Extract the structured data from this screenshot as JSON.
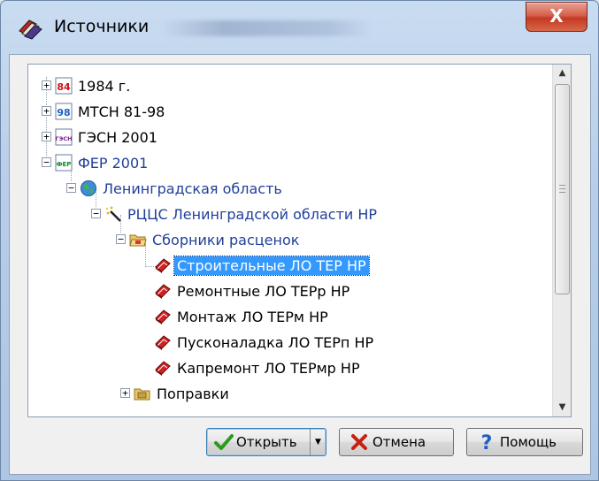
{
  "window": {
    "title": "Источники",
    "close_glyph": "X"
  },
  "tree": {
    "nodes": [
      {
        "label": "1984 г.",
        "icon": "book-84-icon",
        "icon_text": "84"
      },
      {
        "label": "МТСН 81-98",
        "icon": "book-98-icon",
        "icon_text": "98"
      },
      {
        "label": "ГЭСН 2001",
        "icon": "book-gesn-icon",
        "icon_text": "ГЭСН"
      },
      {
        "label": "ФЕР 2001",
        "icon": "book-fer-icon",
        "icon_text": "ФЕР"
      },
      {
        "label": "Ленинградская область",
        "icon": "globe-icon"
      },
      {
        "label": "РЦЦС Ленинградской области НР",
        "icon": "magic-wand-icon"
      },
      {
        "label": "Сборники расценок",
        "icon": "open-folder-icon"
      },
      {
        "label": "Строительные ЛО ТЕР НР",
        "icon": "red-book-icon",
        "selected": true
      },
      {
        "label": "Ремонтные ЛО ТЕРр НР",
        "icon": "red-book-icon"
      },
      {
        "label": "Монтаж ЛО ТЕРм НР",
        "icon": "red-book-icon"
      },
      {
        "label": "Пусконаладка ЛО ТЕРп НР",
        "icon": "red-book-icon"
      },
      {
        "label": "Капремонт ЛО ТЕРмр НР",
        "icon": "red-book-icon"
      },
      {
        "label": "Поправки",
        "icon": "folder-icon"
      }
    ]
  },
  "buttons": {
    "open": "Открыть",
    "cancel": "Отмена",
    "help": "Помощь"
  },
  "colors": {
    "selection": "#3399ff",
    "link_text": "#1f3f9a",
    "close_button": "#c23a23"
  }
}
